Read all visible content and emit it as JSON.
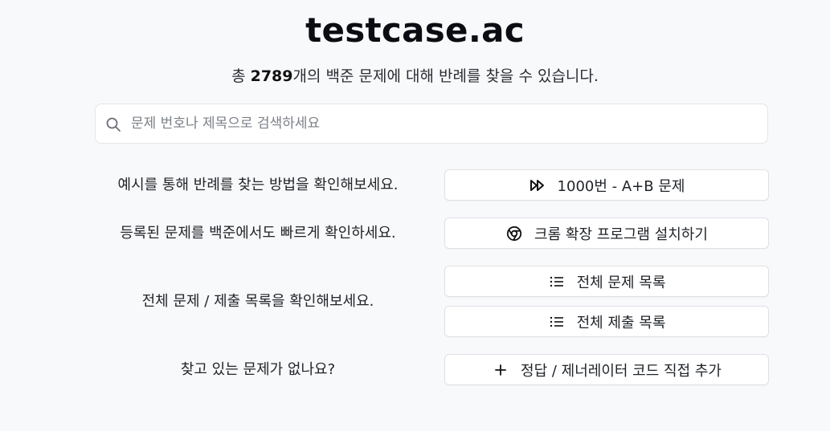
{
  "header": {
    "title": "testcase.ac",
    "subtitle_prefix": "총 ",
    "problem_count": "2789",
    "subtitle_suffix": "개의 백준 문제에 대해 반례를 찾을 수 있습니다."
  },
  "search": {
    "placeholder": "문제 번호나 제목으로 검색하세요",
    "value": "",
    "icon": "search-icon"
  },
  "rows": {
    "example_label": "예시를 통해 반례를 찾는 방법을 확인해보세요.",
    "example_button": "1000번 - A+B 문제",
    "extension_label": "등록된 문제를 백준에서도 빠르게 확인하세요.",
    "extension_button": "크롬 확장 프로그램 설치하기",
    "lists_label": "전체 문제 / 제출 목록을 확인해보세요.",
    "problems_button": "전체 문제 목록",
    "submissions_button": "전체 제출 목록",
    "missing_label": "찾고 있는 문제가 없나요?",
    "add_button": "정답 / 제너레이터 코드 직접 추가"
  },
  "icons": {
    "example": "fast-forward-icon",
    "extension": "chrome-icon",
    "problems": "list-icon",
    "submissions": "list-icon",
    "add": "plus-icon"
  }
}
